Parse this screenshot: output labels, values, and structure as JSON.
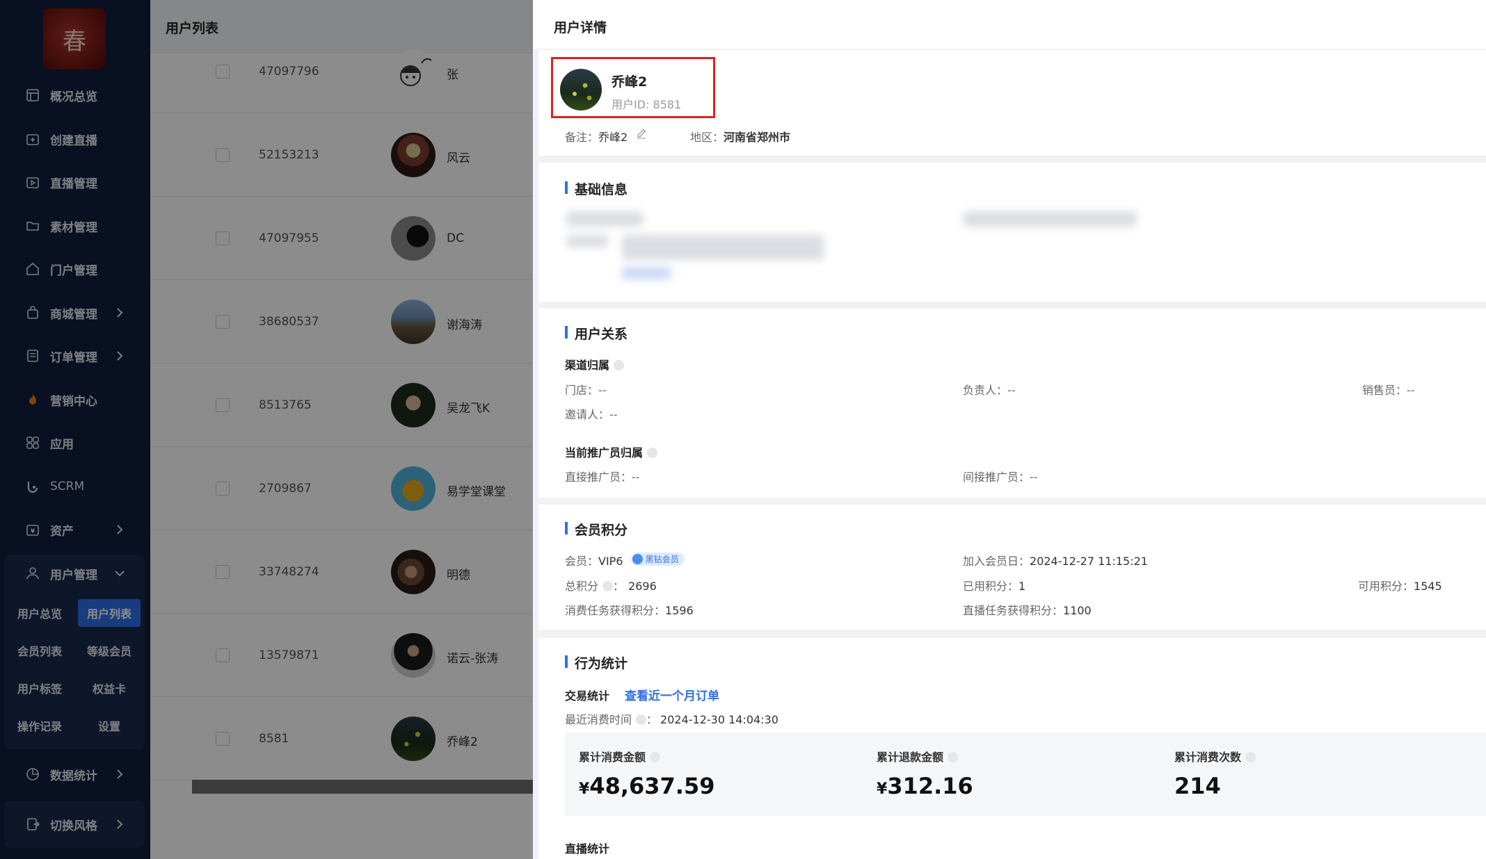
{
  "sidebar": {
    "logo_char": "春",
    "items": [
      {
        "label": "概况总览",
        "icon": "dashboard-icon"
      },
      {
        "label": "创建直播",
        "icon": "create-live-icon"
      },
      {
        "label": "直播管理",
        "icon": "live-manage-icon"
      },
      {
        "label": "素材管理",
        "icon": "folder-icon"
      },
      {
        "label": "门户管理",
        "icon": "home-icon"
      },
      {
        "label": "商城管理",
        "icon": "shop-bag-icon"
      },
      {
        "label": "订单管理",
        "icon": "order-icon"
      },
      {
        "label": "营销中心",
        "icon": "fire-icon"
      },
      {
        "label": "应用",
        "icon": "apps-grid-icon"
      },
      {
        "label": "SCRM",
        "icon": "scrm-icon"
      },
      {
        "label": "资产",
        "icon": "asset-icon"
      },
      {
        "label": "用户管理",
        "icon": "user-icon"
      },
      {
        "label": "数据统计",
        "icon": "pie-chart-icon"
      }
    ],
    "user_submenu": [
      "用户总览",
      "用户列表",
      "会员列表",
      "等级会员",
      "用户标签",
      "权益卡",
      "操作记录",
      "设置"
    ],
    "switch_style": "切换风格"
  },
  "list": {
    "title": "用户列表",
    "rows": [
      {
        "id": "47097796",
        "name": "张"
      },
      {
        "id": "52153213",
        "name": "风云"
      },
      {
        "id": "47097955",
        "name": "DC"
      },
      {
        "id": "38680537",
        "name": "谢海涛"
      },
      {
        "id": "8513765",
        "name": "吴龙飞K"
      },
      {
        "id": "2709867",
        "name": "易学堂课堂"
      },
      {
        "id": "33748274",
        "name": "明德"
      },
      {
        "id": "13579871",
        "name": "诺云-张涛"
      },
      {
        "id": "8581",
        "name": "乔峰2"
      }
    ]
  },
  "detail": {
    "title": "用户详情",
    "profile": {
      "name": "乔峰2",
      "uid": "用户ID: 8581",
      "remark_label": "备注：",
      "remark_value": "乔峰2",
      "region_label": "地区：",
      "region_value": "河南省郑州市"
    },
    "basic_info": {
      "title": "基础信息"
    },
    "relation": {
      "title": "用户关系",
      "channel_title": "渠道归属",
      "store": "门店：--",
      "owner": "负责人：--",
      "sales": "销售员：--",
      "inviter": "邀请人：--",
      "promoter_title": "当前推广员归属",
      "direct_promoter": "直接推广员：--",
      "indirect_promoter": "间接推广员：--"
    },
    "member": {
      "title": "会员积分",
      "level_label": "会员：",
      "level_value": "VIP6",
      "badge": "黑钻会员",
      "join_label": "加入会员日：",
      "join_value": "2024-12-27 11:15:21",
      "total_points_label": "总积分",
      "total_points_value": "2696",
      "used_points_label": "已用积分：",
      "used_points_value": "1",
      "available_points_label": "可用积分：",
      "available_points_value": "1545",
      "consume_task_label": "消费任务获得积分：",
      "consume_task_value": "1596",
      "live_task_label": "直播任务获得积分：",
      "live_task_value": "1100"
    },
    "behavior": {
      "title": "行为统计",
      "trade_title": "交易统计",
      "view_orders_link": "查看近一个月订单",
      "last_consume_label": "最近消费时间",
      "last_consume_value": "2024-12-30 14:04:30",
      "stats": [
        {
          "label": "累计消费金额",
          "currency": "¥",
          "value": "48,637.59"
        },
        {
          "label": "累计退款金额",
          "currency": "¥",
          "value": "312.16"
        },
        {
          "label": "累计消费次数",
          "currency": "",
          "value": "214"
        }
      ],
      "live_title": "直播统计"
    }
  },
  "colors": {
    "sidebar_bg": "#0f1e3d",
    "accent": "#2f6ee8",
    "highlight_border": "#e02020"
  }
}
